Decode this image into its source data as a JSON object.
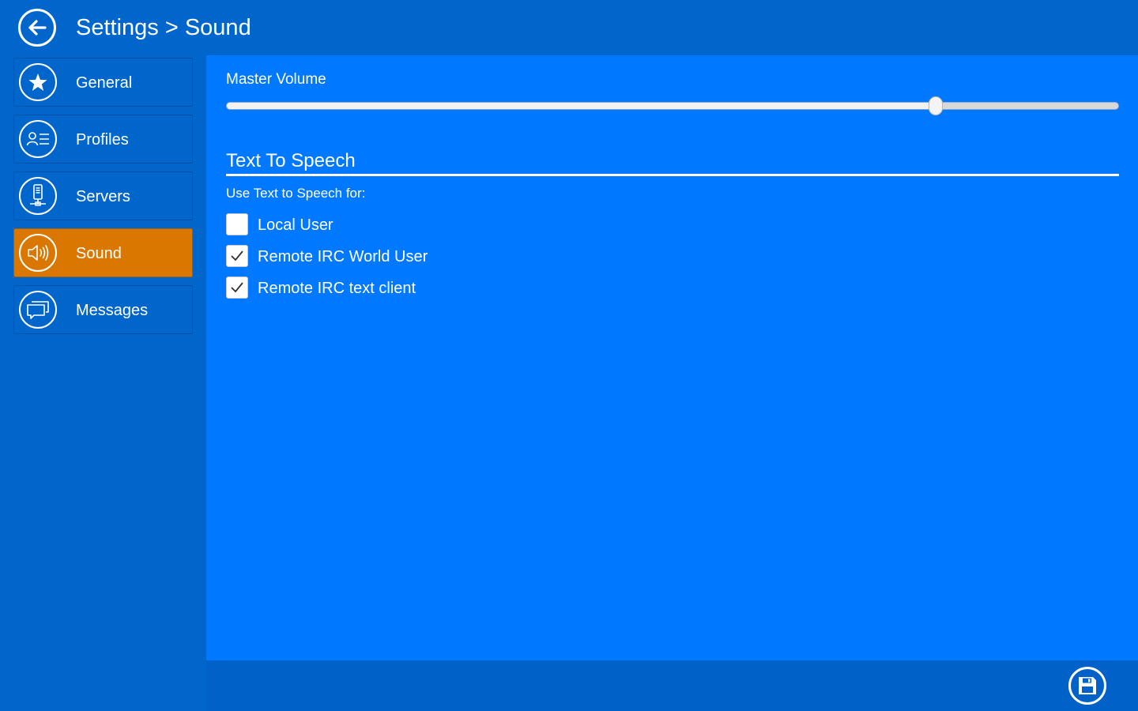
{
  "header": {
    "title": "Settings > Sound",
    "back_icon": "arrow-left-icon"
  },
  "sidebar": {
    "items": [
      {
        "label": "General",
        "icon": "star-icon",
        "active": false
      },
      {
        "label": "Profiles",
        "icon": "profile-card-icon",
        "active": false
      },
      {
        "label": "Servers",
        "icon": "server-icon",
        "active": false
      },
      {
        "label": "Sound",
        "icon": "speaker-icon",
        "active": true
      },
      {
        "label": "Messages",
        "icon": "chat-bubbles-icon",
        "active": false
      }
    ]
  },
  "main": {
    "master_volume": {
      "label": "Master Volume",
      "value_percent": 79.5
    },
    "tts": {
      "heading": "Text To Speech",
      "description": "Use Text to Speech for:",
      "options": [
        {
          "label": "Local User",
          "checked": false
        },
        {
          "label": "Remote IRC World User",
          "checked": true
        },
        {
          "label": "Remote IRC text client",
          "checked": true
        }
      ]
    }
  },
  "footer": {
    "save_icon": "floppy-disk-icon"
  },
  "colors": {
    "background": "#0066cc",
    "content": "#0078ff",
    "active": "#d97700",
    "footer": "#0061c8"
  }
}
